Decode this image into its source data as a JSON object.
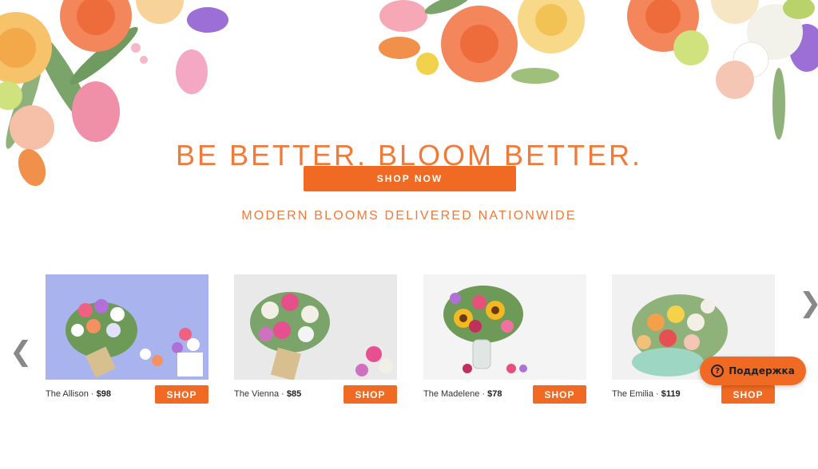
{
  "hero": {
    "title": "BE BETTER. BLOOM BETTER.",
    "shop_now_label": "SHOP NOW",
    "tagline": "MODERN BLOOMS DELIVERED NATIONWIDE"
  },
  "carousel": {
    "prev_icon": "chevron-left-icon",
    "next_icon": "chevron-right-icon",
    "prev_glyph": "❮",
    "next_glyph": "❯",
    "products": [
      {
        "name": "The Allison",
        "separator": " · ",
        "price": "$98",
        "shop_label": "SHOP",
        "bg": "#a9b3ee"
      },
      {
        "name": "The Vienna",
        "separator": " · ",
        "price": "$85",
        "shop_label": "SHOP",
        "bg": "#e9e9e9"
      },
      {
        "name": "The Madelene",
        "separator": " · ",
        "price": "$78",
        "shop_label": "SHOP",
        "bg": "#f4f4f4"
      },
      {
        "name": "The Emilia",
        "separator": " · ",
        "price": "$119",
        "shop_label": "SHOP",
        "bg": "#f1f1f1"
      }
    ]
  },
  "support": {
    "label": "Поддержка",
    "icon": "question-icon",
    "icon_glyph": "?"
  },
  "colors": {
    "accent": "#f06a24",
    "heading": "#f07a3a"
  }
}
